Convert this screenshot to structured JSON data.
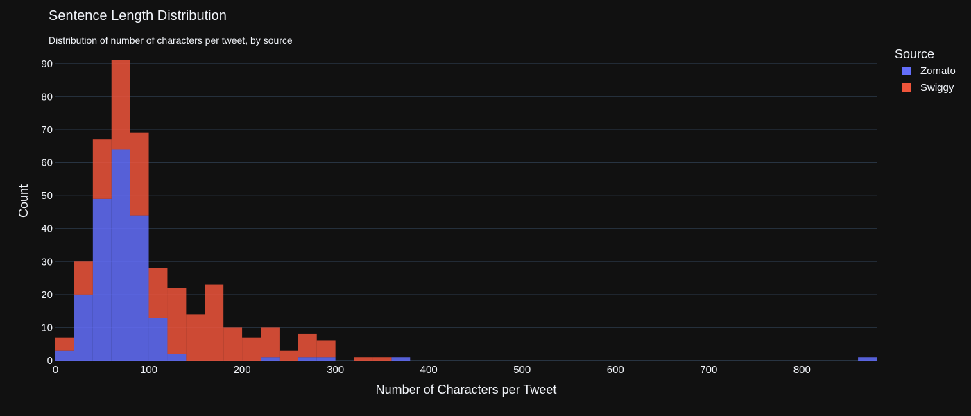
{
  "chart_data": {
    "type": "bar",
    "barmode": "stack",
    "title": "Sentence Length Distribution",
    "subtitle": "Distribution of number of characters per tweet, by source",
    "xlabel": "Number of Characters per Tweet",
    "ylabel": "Count",
    "xlim": [
      0,
      880
    ],
    "ylim": [
      0,
      91
    ],
    "bin_width": 20,
    "x_ticks": [
      0,
      100,
      200,
      300,
      400,
      500,
      600,
      700,
      800
    ],
    "y_ticks": [
      0,
      10,
      20,
      30,
      40,
      50,
      60,
      70,
      80,
      90
    ],
    "grid": true,
    "legend_title": "Source",
    "legend_position": "top-right",
    "series": [
      {
        "name": "Zomato",
        "color": "#636efa",
        "bins": [
          {
            "x0": 0,
            "count": 3
          },
          {
            "x0": 20,
            "count": 20
          },
          {
            "x0": 40,
            "count": 49
          },
          {
            "x0": 60,
            "count": 64
          },
          {
            "x0": 80,
            "count": 44
          },
          {
            "x0": 100,
            "count": 13
          },
          {
            "x0": 120,
            "count": 2
          },
          {
            "x0": 220,
            "count": 1
          },
          {
            "x0": 260,
            "count": 1
          },
          {
            "x0": 280,
            "count": 1
          },
          {
            "x0": 360,
            "count": 1
          },
          {
            "x0": 860,
            "count": 1
          }
        ]
      },
      {
        "name": "Swiggy",
        "color": "#ef553b",
        "bins": [
          {
            "x0": 0,
            "count": 4
          },
          {
            "x0": 20,
            "count": 10
          },
          {
            "x0": 40,
            "count": 18
          },
          {
            "x0": 60,
            "count": 27
          },
          {
            "x0": 80,
            "count": 25
          },
          {
            "x0": 100,
            "count": 15
          },
          {
            "x0": 120,
            "count": 20
          },
          {
            "x0": 140,
            "count": 14
          },
          {
            "x0": 160,
            "count": 23
          },
          {
            "x0": 180,
            "count": 10
          },
          {
            "x0": 200,
            "count": 7
          },
          {
            "x0": 220,
            "count": 9
          },
          {
            "x0": 240,
            "count": 3
          },
          {
            "x0": 260,
            "count": 7
          },
          {
            "x0": 280,
            "count": 5
          },
          {
            "x0": 320,
            "count": 1
          },
          {
            "x0": 340,
            "count": 1
          }
        ]
      }
    ]
  },
  "colors": {
    "background": "#111111",
    "grid": "#283442",
    "text": "#f2f5fa"
  }
}
